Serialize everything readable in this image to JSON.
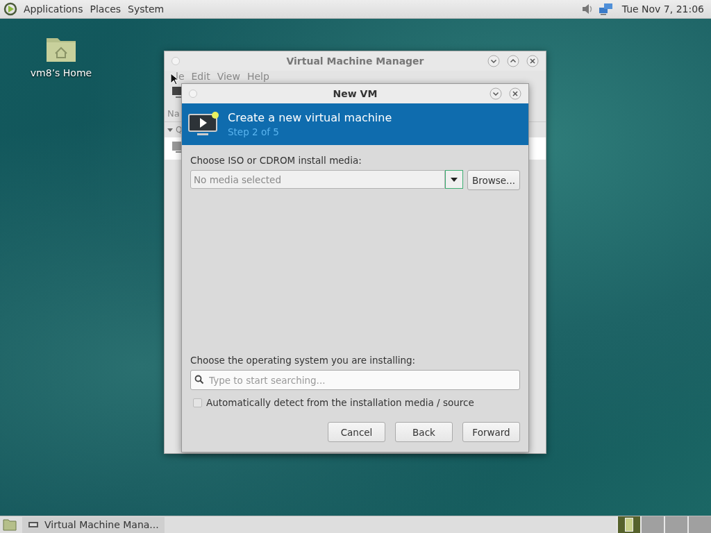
{
  "top_panel": {
    "menus": [
      "Applications",
      "Places",
      "System"
    ],
    "clock": "Tue Nov 7, 21:06"
  },
  "desktop_icons": [
    {
      "label": "vm8’s Home"
    }
  ],
  "manager_window": {
    "title": "Virtual Machine Manager",
    "menus": [
      "le",
      "Edit",
      "View",
      "Help"
    ],
    "column_header": "Na",
    "group": "Q"
  },
  "dialog": {
    "title": "New VM",
    "header_title": "Create a new virtual machine",
    "step": "Step 2 of 5",
    "media_label": "Choose ISO or CDROM install media:",
    "media_combo": {
      "placeholder": "No media selected"
    },
    "browse_button": "Browse...",
    "os_label": "Choose the operating system you are installing:",
    "os_search": {
      "placeholder": "Type to start searching..."
    },
    "auto_detect": {
      "label": "Automatically detect from the installation media / source",
      "checked": false
    },
    "buttons": [
      "Cancel",
      "Back",
      "Forward"
    ]
  },
  "taskbar": {
    "tasks": [
      {
        "label": "Virtual Machine Mana..."
      }
    ],
    "workspaces": [
      {
        "selected": true
      },
      {
        "selected": false
      },
      {
        "selected": false
      },
      {
        "selected": false
      }
    ]
  }
}
